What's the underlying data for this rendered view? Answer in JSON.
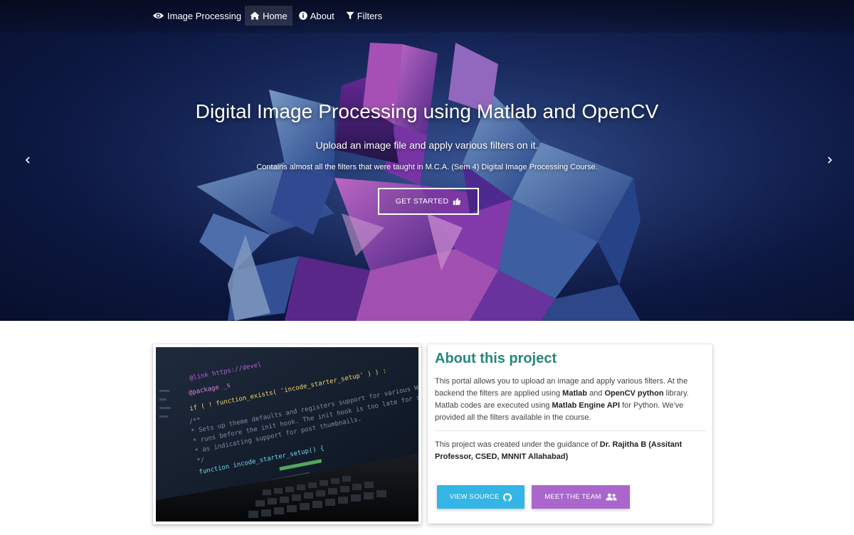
{
  "navbar": {
    "brand": "Image Processing",
    "links": [
      {
        "label": "Home",
        "active": true
      },
      {
        "label": "About"
      },
      {
        "label": "Filters"
      }
    ]
  },
  "hero": {
    "title": "Digital Image Processing using Matlab and OpenCV",
    "subtitle": "Upload an image file and apply various filters on it.",
    "note": "Contains almost all the filters that were taught in M.C.A. (Sem 4) Digital Image Processing Course.",
    "cta_label": "GET STARTED"
  },
  "about": {
    "title": "About this project",
    "description": {
      "p1": "This portal allows you to upload an image and apply various filters. At the backend the filters are applied using ",
      "b1": "Matlab",
      "p2": " and ",
      "b2": "OpenCV python",
      "p3": " library. Matlab codes are executed using ",
      "b3": "Matlab Engine API",
      "p4": " for Python. We've provided all the filters available in the course."
    },
    "guidance": {
      "p1": "This project was created under the guidance of ",
      "b1": "Dr. Rajitha B (Assitant Professor, CSED, MNNIT Allahabad)"
    },
    "view_source_label": "VIEW SOURCE",
    "meet_team_label": "MEET THE TEAM"
  },
  "code_image": {
    "lines": [
      "@link https://devel",
      "@package _s",
      "if ( ! function_exists( 'incode_starter_setup' ) ) :",
      "/**",
      " * Sets up theme defaults and registers support for various WordPress",
      " * runs before the init hook. The init hook is too late for some features",
      " * as indicating support for post thumbnails.",
      " */",
      "function incode_starter_setup() {"
    ]
  },
  "colors": {
    "accent_teal": "#26877c",
    "source_button": "#33b5e5",
    "team_button": "#aa66cc"
  },
  "icons": {
    "brand": "eye-icon",
    "home": "home-icon",
    "about": "info-icon",
    "filters": "filter-icon",
    "cta": "thumbs-up-icon",
    "source": "github-icon",
    "team": "users-icon"
  }
}
